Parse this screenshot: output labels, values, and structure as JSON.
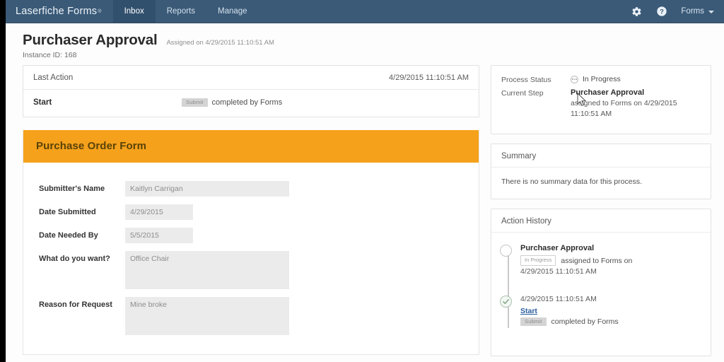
{
  "topnav": {
    "brand": "Laserfiche Forms",
    "brand_tm": "®",
    "tabs": [
      {
        "label": "Inbox",
        "active": true
      },
      {
        "label": "Reports",
        "active": false
      },
      {
        "label": "Manage",
        "active": false
      }
    ],
    "settings_icon": "gear-icon",
    "help_icon": "question-circle-icon",
    "user_label": "Forms"
  },
  "page": {
    "title": "Purchaser Approval",
    "assigned_on": "Assigned on 4/29/2015 11:10:51 AM",
    "instance_id": "Instance ID: 168"
  },
  "last_action": {
    "heading": "Last Action",
    "timestamp": "4/29/2015 11:10:51 AM",
    "step": "Start",
    "badge": "Submit",
    "detail": "completed by Forms"
  },
  "form": {
    "banner_title": "Purchase Order Form",
    "fields": [
      {
        "label": "Submitter's Name",
        "value": "Kaitlyn Carrigan",
        "size": "wide"
      },
      {
        "label": "Date Submitted",
        "value": "4/29/2015",
        "size": "narrow"
      },
      {
        "label": "Date Needed By",
        "value": "5/5/2015",
        "size": "narrow"
      },
      {
        "label": "What do you want?",
        "value": "Office Chair",
        "size": "area"
      },
      {
        "label": "Reason for Request",
        "value": "Mine broke",
        "size": "area"
      }
    ]
  },
  "process_status": {
    "status_key": "Process Status",
    "status_value": "In Progress",
    "status_icon": "in-progress-dots-icon",
    "step_key": "Current Step",
    "step_name": "Purchaser Approval",
    "step_detail": "assigned to Forms on 4/29/2015 11:10:51 AM"
  },
  "summary": {
    "heading": "Summary",
    "text": "There is no summary data for this process."
  },
  "action_history": {
    "heading": "Action History",
    "items": [
      {
        "node": "open",
        "title": "Purchaser Approval",
        "badge": "In Progress",
        "badge_style": "outline",
        "detail": "assigned to Forms on",
        "date": "4/29/2015 11:10:51 AM",
        "link": ""
      },
      {
        "node": "done",
        "title": "",
        "badge": "Submit",
        "badge_style": "solid",
        "detail": "completed by Forms",
        "date": "4/29/2015 11:10:51 AM",
        "link": "Start"
      }
    ]
  },
  "colors": {
    "navbar": "#3a5a78",
    "navbar_active": "#31506d",
    "form_banner": "#f5a11b",
    "link": "#2b5f9e",
    "field_bg": "#ebebeb"
  }
}
